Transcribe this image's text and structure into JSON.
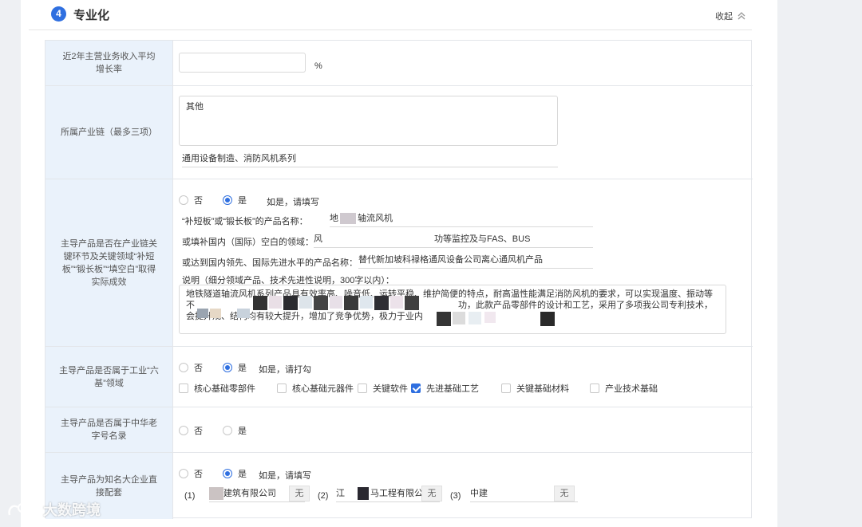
{
  "section": {
    "step": "4",
    "title": "专业化",
    "collapse_label": "收起"
  },
  "rows": {
    "growth": {
      "label": "近2年主营业务收入平均增长率",
      "value": "",
      "unit": "%"
    },
    "chain": {
      "label": "所属产业链（最多三项）",
      "textarea_value": "其他",
      "chain_value": "通用设备制造、消防风机系列"
    },
    "key_link": {
      "label": "主导产品是否在产业链关键环节及关键领域“补短板”“锻长板”“填空白”取得实际成效",
      "opt_no": "否",
      "opt_yes": "是",
      "hint": "如是，请填写",
      "product_label": "“补短板”或“锻长板”的产品名称：",
      "product_value_a": "地",
      "product_value_b": "轴流风机",
      "gap_label": "或填补国内（国际）空白的领域：",
      "gap_value_a": "风",
      "gap_value_b": "功等监控及与FAS、BUS",
      "lead_label": "或达到国内领先、国际先进水平的产品名称：",
      "lead_value": "替代新加坡科禄格通风设备公司离心通风机产品",
      "desc_label": "说明（细分领域产品、技术先进性说明，300字以内）：",
      "desc_line1": "地铁隧道轴流风机系列产品具有效率高、噪音低、运转平稳、维护简便的特点，耐高温性能满足消防风机的要求，可以实现温度、振动等",
      "desc_line2_a": "不",
      "desc_line2_b": "功，此款产品零部件的设计和工艺，采用了多项我公司专利技术，",
      "desc_line3": "会提升规、结构均有较大提升，增加了竞争优势，极力于业内"
    },
    "six_base": {
      "label": "主导产品是否属于工业“六基”领域",
      "opt_no": "否",
      "opt_yes": "是",
      "hint": "如是，请打勾",
      "checks": [
        {
          "label": "核心基础零部件",
          "checked": false
        },
        {
          "label": "核心基础元器件",
          "checked": false
        },
        {
          "label": "关键软件",
          "checked": false
        },
        {
          "label": "先进基础工艺",
          "checked": true
        },
        {
          "label": "关键基础材料",
          "checked": false
        },
        {
          "label": "产业技术基础",
          "checked": false
        }
      ]
    },
    "old_brand": {
      "label": "主导产品是否属于中华老字号名录",
      "opt_no": "否",
      "opt_yes": "是"
    },
    "supplier": {
      "label": "主导产品为知名大企业直接配套",
      "opt_no": "否",
      "opt_yes": "是",
      "hint": "如是，请填写",
      "items": [
        {
          "index": "(1)",
          "value": "建筑有限公司",
          "button": "无"
        },
        {
          "index": "(2)",
          "value_a": "江",
          "value_b": "马工程有限公司",
          "button": "无"
        },
        {
          "index": "(3)",
          "value": "中建",
          "button": "无"
        }
      ]
    }
  },
  "watermark": {
    "text": "大数跨境"
  }
}
